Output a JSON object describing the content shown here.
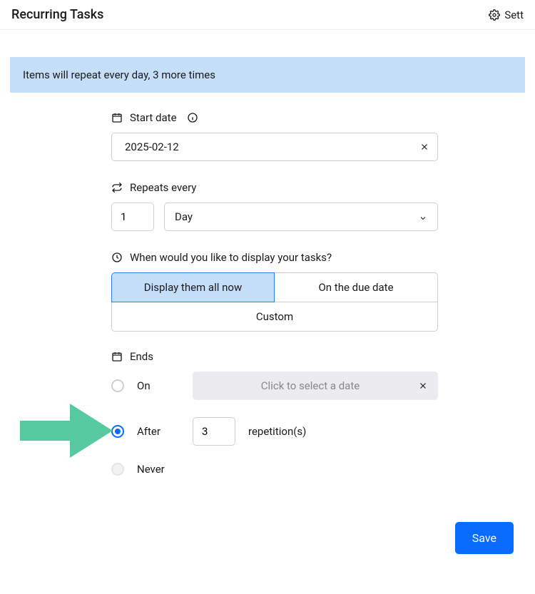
{
  "header": {
    "title": "Recurring Tasks",
    "settings_label": "Sett"
  },
  "notice": "Items will repeat every day, 3 more times",
  "start_date": {
    "label": "Start date",
    "value": "2025-02-12"
  },
  "repeats": {
    "label": "Repeats every",
    "interval": "1",
    "unit": "Day"
  },
  "display": {
    "label": "When would you like to display your tasks?",
    "options": {
      "all_now": "Display them all now",
      "due_date": "On the due date",
      "custom": "Custom"
    },
    "selected": "all_now"
  },
  "ends": {
    "label": "Ends",
    "on": {
      "label": "On",
      "placeholder": "Click to select a date"
    },
    "after": {
      "label": "After",
      "count": "3",
      "suffix": "repetition(s)"
    },
    "never": {
      "label": "Never"
    },
    "selected": "after"
  },
  "save_label": "Save"
}
